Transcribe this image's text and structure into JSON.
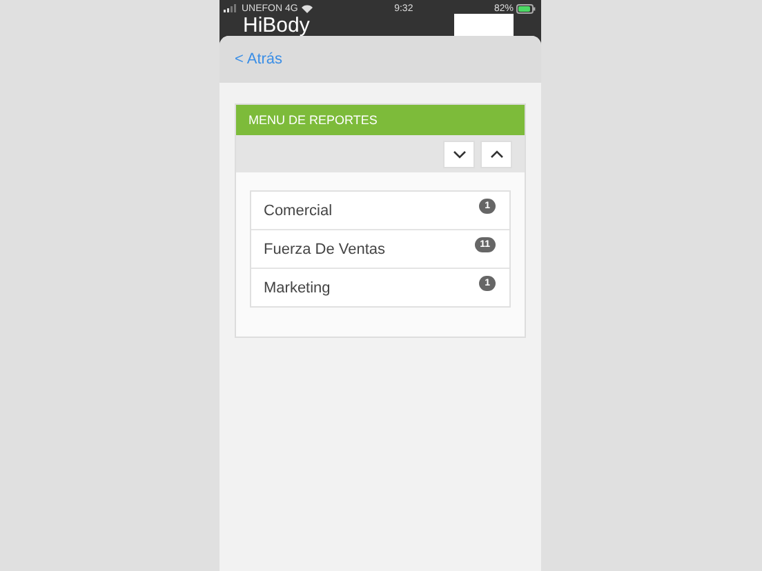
{
  "status_bar": {
    "carrier": "UNEFON 4G",
    "time": "9:32",
    "battery": "82%"
  },
  "app_title": "HiBody",
  "nav": {
    "back": "< Atrás"
  },
  "panel": {
    "title": "MENU DE REPORTES",
    "buttons": [
      {
        "kind": "collapse"
      },
      {
        "kind": "expand"
      }
    ],
    "items": [
      {
        "label": "Comercial",
        "count": "1"
      },
      {
        "label": "Fuerza De Ventas",
        "count": "11"
      },
      {
        "label": "Marketing",
        "count": "1"
      }
    ]
  }
}
